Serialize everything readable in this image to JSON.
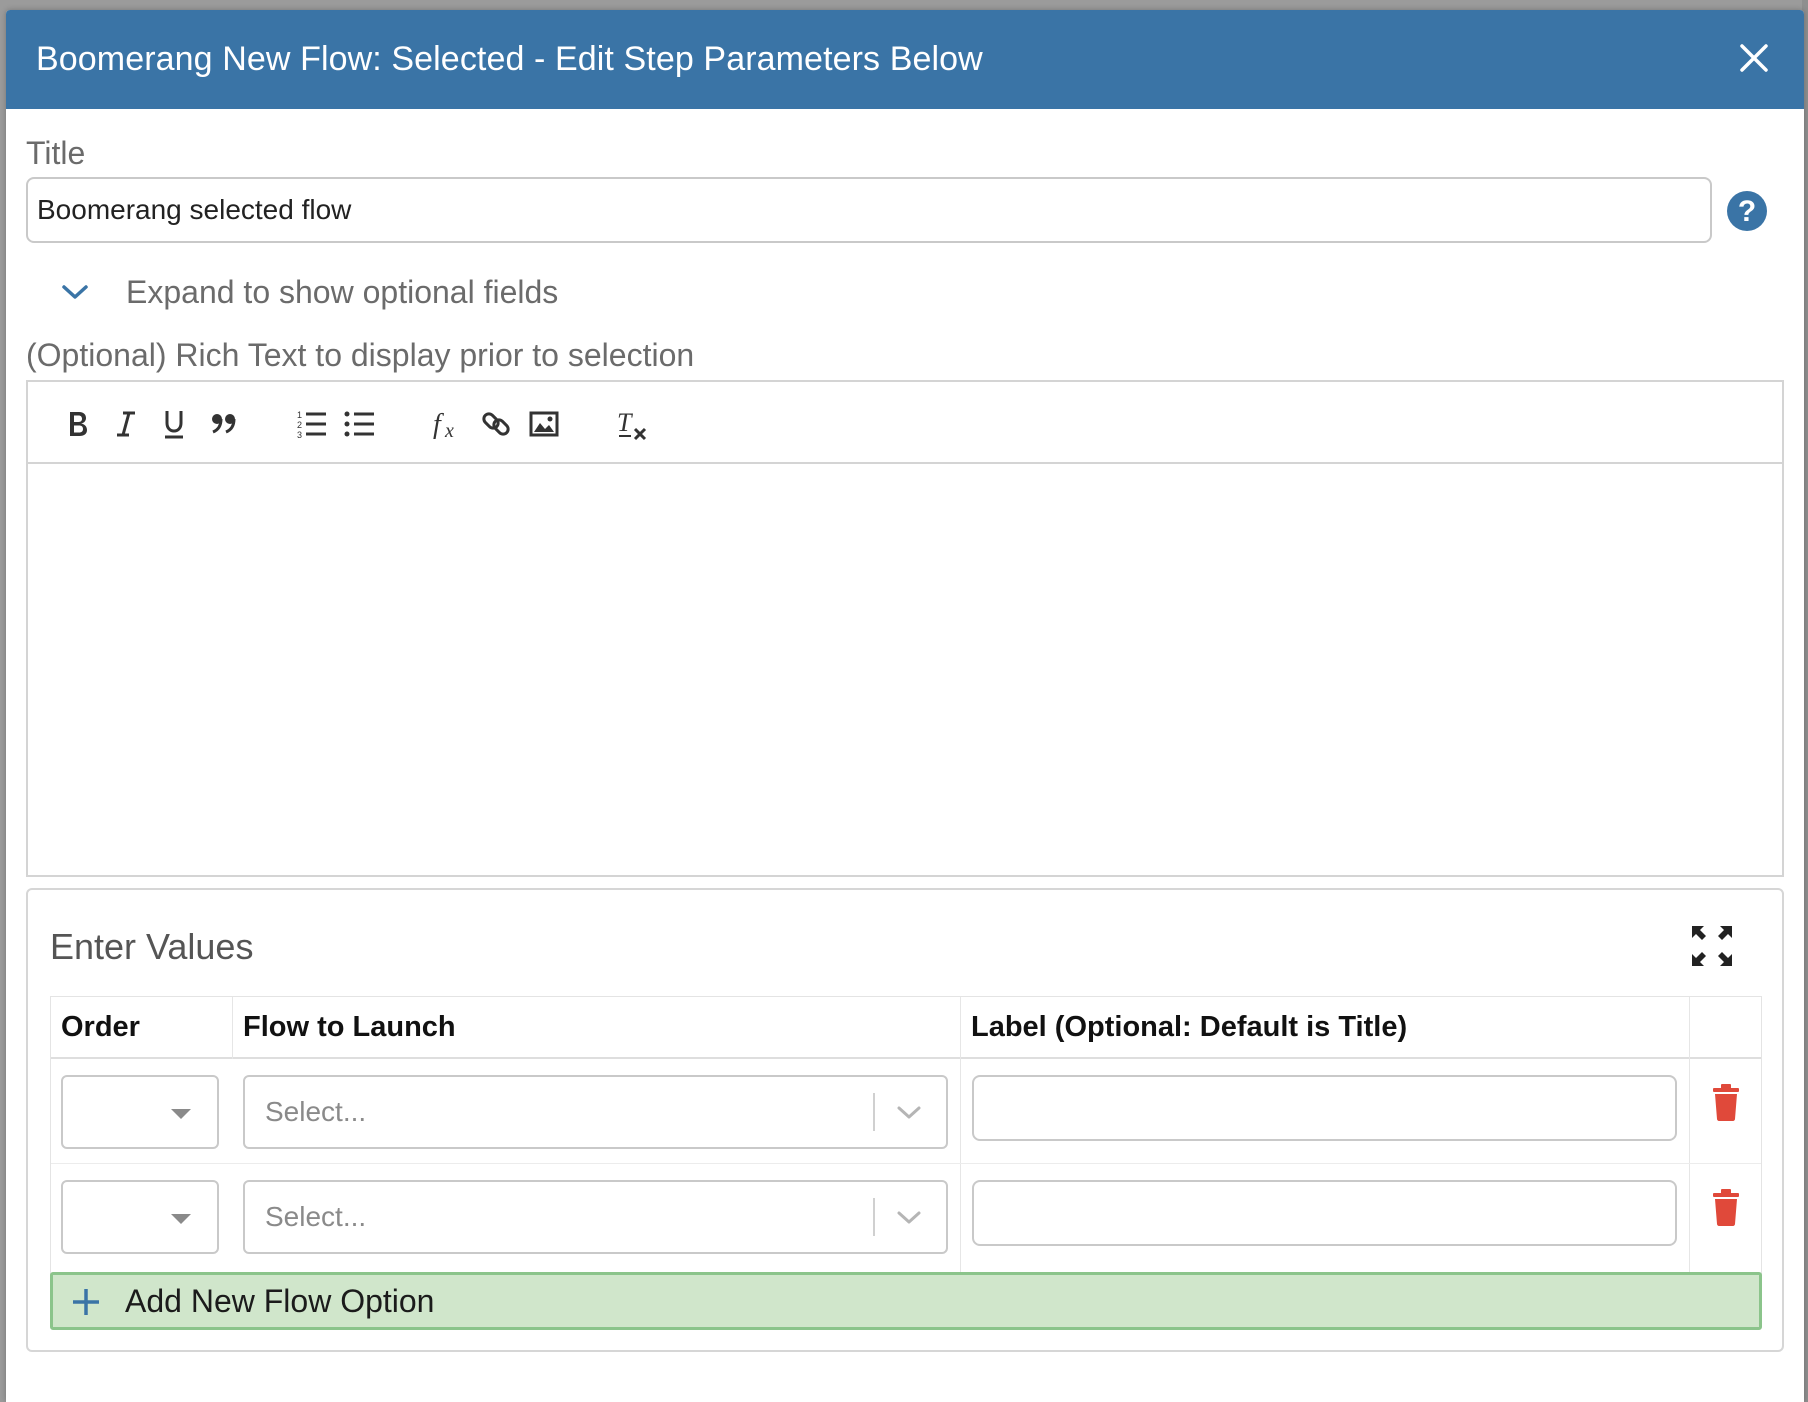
{
  "modal": {
    "title": "Boomerang New Flow: Selected - Edit Step Parameters Below",
    "close_icon": "close-icon"
  },
  "title_field": {
    "label": "Title",
    "value": "Boomerang selected flow",
    "help_icon": "help-icon"
  },
  "optional_toggle": {
    "label": "Expand to show optional fields",
    "icon": "chevron-down-icon"
  },
  "rich_text": {
    "label": "(Optional) Rich Text to display prior to selection",
    "toolbar": [
      "bold-icon",
      "italic-icon",
      "underline-icon",
      "blockquote-icon",
      "numbered-list-icon",
      "bulleted-list-icon",
      "formula-icon",
      "link-icon",
      "image-icon",
      "clear-format-icon"
    ]
  },
  "values_panel": {
    "title": "Enter Values",
    "fullscreen_icon": "fullscreen-icon",
    "columns": [
      "Order",
      "Flow to Launch",
      "Label (Optional: Default is Title)"
    ],
    "rows": [
      {
        "order": "",
        "flow_placeholder": "Select...",
        "label": ""
      },
      {
        "order": "",
        "flow_placeholder": "Select...",
        "label": ""
      }
    ],
    "add_button_label": "Add New Flow Option"
  },
  "colors": {
    "header_bg": "#3a74a6",
    "help_icon": "#3a74a6",
    "trash_icon": "#e0493a",
    "add_button_bg": "#d0e6cb",
    "add_button_border": "#8bc48b"
  }
}
